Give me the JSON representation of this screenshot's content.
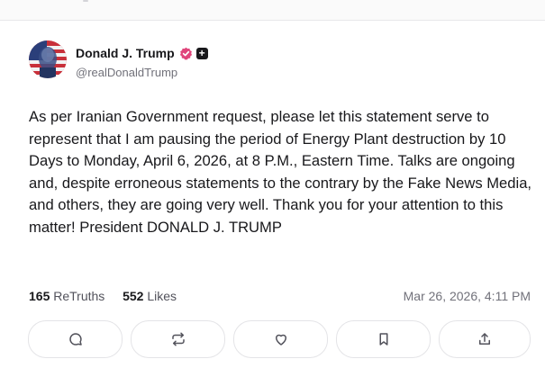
{
  "author": {
    "display_name": "Donald J. Trump",
    "handle": "@realDonaldTrump",
    "verified_icon": "verified-badge-icon",
    "plus_icon": "plus-badge-icon"
  },
  "post": {
    "text": "As per Iranian Government request, please let this statement serve to represent that I am pausing the period of Energy Plant destruction by 10 Days to Monday, April 6, 2026, at 8 P.M., Eastern Time. Talks are ongoing and, despite erroneous statements to the contrary by the Fake News Media, and others, they are going very well. Thank you for your attention to this matter! President DONALD J. TRUMP"
  },
  "stats": {
    "retruths_count": "165",
    "retruths_label": "ReTruths",
    "likes_count": "552",
    "likes_label": "Likes",
    "timestamp": "Mar 26, 2026, 4:11 PM"
  },
  "actions": [
    {
      "name": "reply",
      "icon": "comment-icon"
    },
    {
      "name": "retruth",
      "icon": "repost-icon"
    },
    {
      "name": "like",
      "icon": "heart-icon"
    },
    {
      "name": "bookmark",
      "icon": "bookmark-icon"
    },
    {
      "name": "share",
      "icon": "share-icon"
    }
  ],
  "colors": {
    "verified": "#e0457b",
    "text": "#18181b",
    "muted": "#71717a",
    "border": "#e4e4e7"
  }
}
